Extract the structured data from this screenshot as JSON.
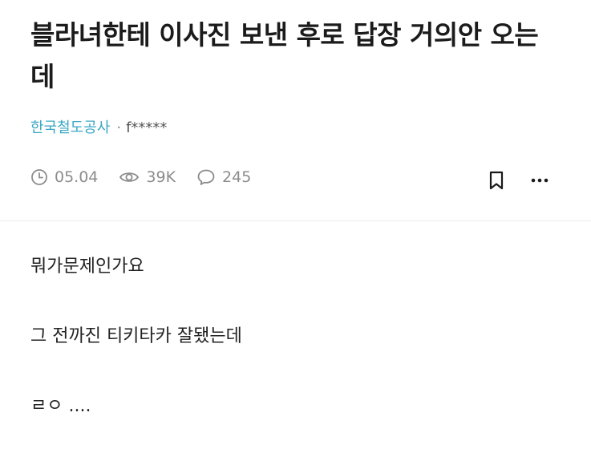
{
  "post": {
    "title": "블라녀한테 이사진 보낸 후로 답장 거의안 오는데",
    "company": "한국철도공사",
    "separator": "·",
    "username": "f*****",
    "date": "05.04",
    "views": "39K",
    "comments": "245",
    "body": [
      "뭐가문제인가요",
      "그 전까진 티키타카 잘됐는데",
      "ㄹㅇ ...."
    ]
  },
  "icons": {
    "date": "clock-icon",
    "views": "eye-icon",
    "comments": "comment-bubble-icon",
    "bookmark": "bookmark-icon",
    "more": "more-dots-icon"
  },
  "colors": {
    "company": "#3aa7c6",
    "meta": "#8c8c8c"
  }
}
